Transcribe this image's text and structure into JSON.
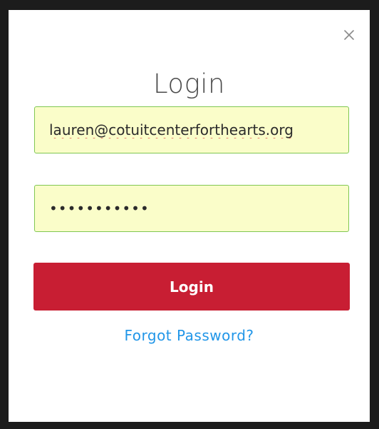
{
  "modal": {
    "title": "Login",
    "close_icon": "close-icon",
    "email": {
      "value": "lauren@cotuitcenterforthearts.org",
      "spellcheck_error": true
    },
    "password": {
      "masked_value": "•••••••••••"
    },
    "login_button_label": "Login",
    "forgot_password_label": "Forgot Password?"
  },
  "colors": {
    "overlay_background": "#1c1c1c",
    "modal_background": "#ffffff",
    "input_autofill_background": "#fafdc9",
    "input_border": "#80c752",
    "login_button": "#c81e33",
    "link": "#2196e8",
    "title_text": "#4b4b4b"
  }
}
